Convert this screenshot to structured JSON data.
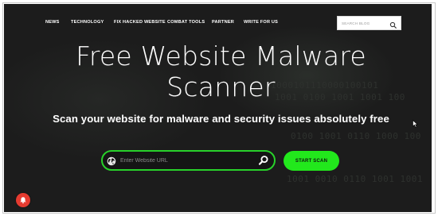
{
  "nav": {
    "items": [
      {
        "label": "NEWS"
      },
      {
        "label": "TECHNOLOGY"
      },
      {
        "label": "FIX HACKED WEBSITE"
      },
      {
        "label": "COMBAT TOOLS"
      },
      {
        "label": "PARTNER"
      },
      {
        "label": "WRITE FOR US"
      }
    ],
    "search": {
      "placeholder": "SEARCH BLOG",
      "icon": "search-icon"
    }
  },
  "hero": {
    "title_line1": "Free Website Malware",
    "title_line2": "Scanner",
    "subtitle": "Scan your website for malware and security issues absolutely free",
    "binary_lines": [
      "1000101110000100101",
      "1001 0100 1001 1001 100",
      "0100 1001 0110 1000 100",
      "1001 0010 0110 1001 1001"
    ],
    "url_input": {
      "placeholder": "Enter Website URL",
      "value": ""
    },
    "start_button": "START SCAN"
  },
  "colors": {
    "background": "#1c1c1c",
    "accent": "#22e81c",
    "notification": "#e53b30"
  },
  "icons": [
    "search-icon",
    "globe-icon",
    "magnifier-icon",
    "bell-icon",
    "mouse-cursor-icon"
  ]
}
